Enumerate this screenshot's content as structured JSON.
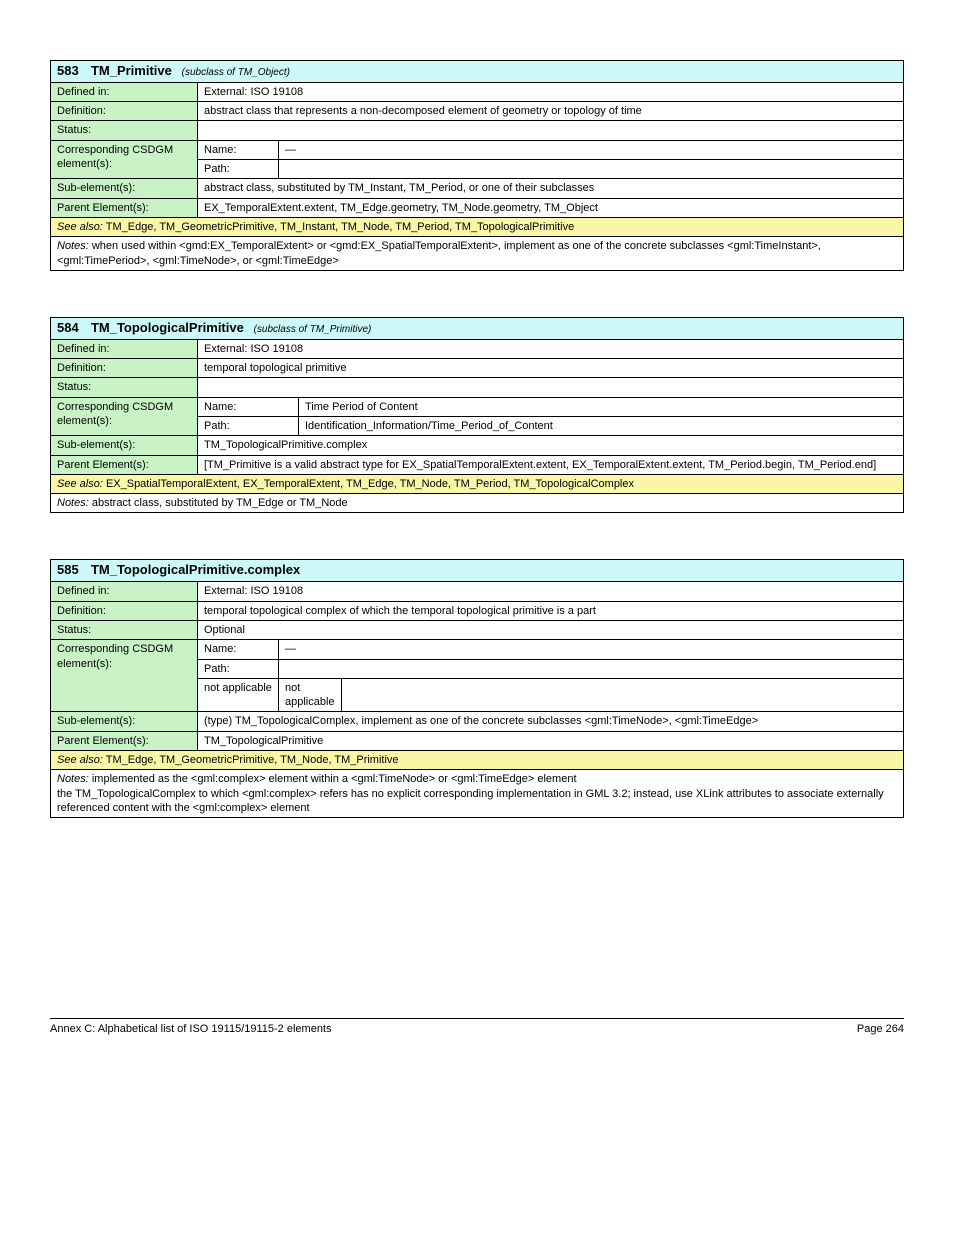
{
  "labels": {
    "defined_in": "Defined in:",
    "definition": "Definition:",
    "status": "Status:",
    "corresponding_csdgm": "Corresponding CSDGM element(s):",
    "name": "Name:",
    "path": "Path:",
    "subelements": "Sub-element(s):",
    "parent_elements": "Parent Element(s):",
    "see_also": "See also:",
    "notes_label": "Notes:"
  },
  "footer": {
    "left": "Annex C: Alphabetical list of ISO 19115/19115-2 elements",
    "right": "Page 264"
  },
  "entries": [
    {
      "serial": "583",
      "primary": "TM_Primitive",
      "secondary": "(subclass of TM_Object)",
      "defined_in": "External: ISO 19108",
      "definition": "abstract class that represents a non-decomposed element of geometry or topology of time",
      "status": "",
      "csdgm": [
        {
          "name": "—",
          "path": ""
        }
      ],
      "subelements": "abstract class, substituted by TM_Instant, TM_Period, or one of their subclasses",
      "parent_elements": "EX_TemporalExtent.extent, TM_Edge.geometry, TM_Node.geometry, TM_Object",
      "also": "TM_Edge, TM_GeometricPrimitive, TM_Instant, TM_Node, TM_Period, TM_TopologicalPrimitive",
      "notes": [
        "when used within <gmd:EX_TemporalExtent> or <gmd:EX_SpatialTemporalExtent>, implement as one of the concrete subclasses <gml:TimeInstant>, <gml:TimePeriod>, <gml:TimeNode>, or <gml:TimeEdge>"
      ]
    },
    {
      "serial": "584",
      "primary": "TM_TopologicalPrimitive",
      "secondary": "(subclass of TM_Primitive)",
      "defined_in": "External: ISO 19108",
      "definition": "temporal topological primitive",
      "status": "",
      "csdgm": [
        {
          "name": "Time Period of Content",
          "path": "Identification_Information/Time_Period_of_Content"
        }
      ],
      "subelements": "TM_TopologicalPrimitive.complex",
      "parent_elements": "[TM_Primitive is a valid abstract type for EX_SpatialTemporalExtent.extent, EX_TemporalExtent.extent,  TM_Period.begin, TM_Period.end]",
      "also": "EX_SpatialTemporalExtent, EX_TemporalExtent, TM_Edge, TM_Node, TM_Period, TM_TopologicalComplex",
      "notes": [
        "abstract class, substituted by TM_Edge or TM_Node"
      ]
    },
    {
      "serial": "585",
      "primary": "TM_TopologicalPrimitive.complex",
      "secondary": "",
      "defined_in": "External: ISO 19108",
      "definition": "temporal topological complex of which the temporal topological primitive is a part",
      "status": "Optional",
      "csdgm": [
        {
          "name": "—",
          "path": ""
        },
        {
          "name": "not applicable",
          "path": "not applicable"
        }
      ],
      "subelements": "(type) TM_TopologicalComplex, implement as one of the concrete subclasses <gml:TimeNode>,   <gml:TimeEdge>",
      "parent_elements": "TM_TopologicalPrimitive",
      "also": "TM_Edge, TM_GeometricPrimitive, TM_Node, TM_Primitive",
      "notes": [
        "implemented as the <gml:complex> element within a <gml:TimeNode> or <gml:TimeEdge> element",
        "the TM_TopologicalComplex to which <gml:complex> refers has no explicit corresponding implementation in GML 3.2; instead, use XLink attributes to associate externally referenced content with the <gml:complex> element"
      ]
    }
  ]
}
